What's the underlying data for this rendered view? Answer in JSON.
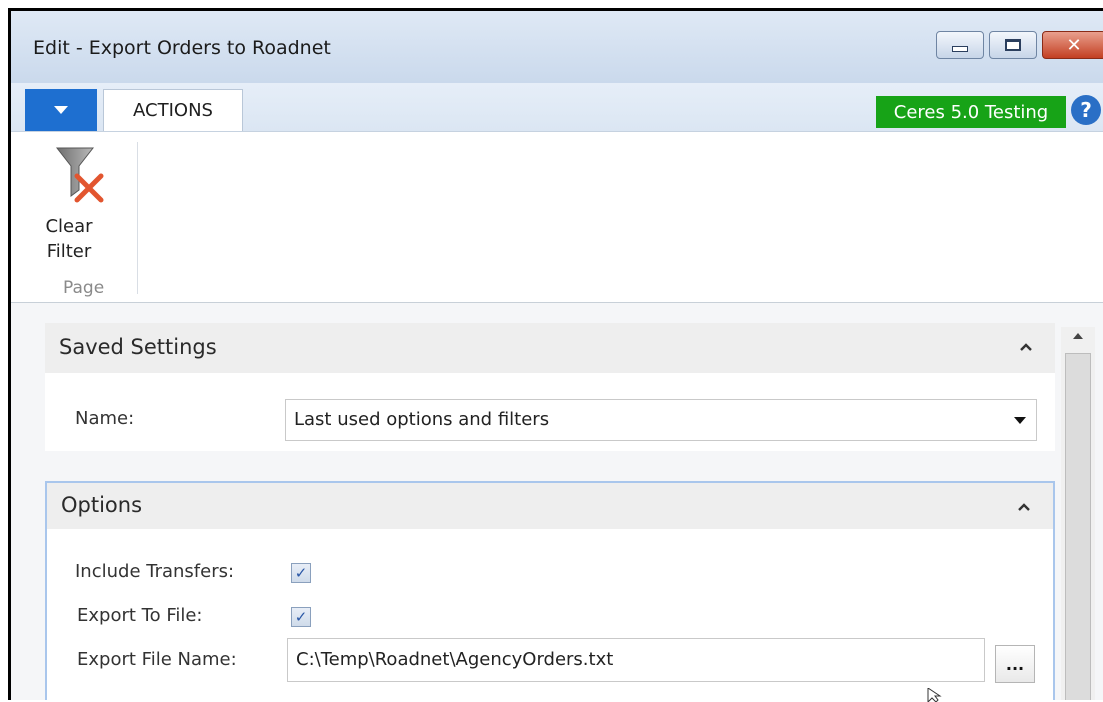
{
  "window": {
    "title": "Edit - Export Orders to Roadnet",
    "controls": {
      "minimize_icon": "minimize-icon",
      "maximize_icon": "maximize-icon",
      "close_icon": "close-icon",
      "close_glyph": "✕"
    }
  },
  "ribbon": {
    "tab_actions": "ACTIONS",
    "environment_badge": "Ceres 5.0 Testing",
    "help_glyph": "?",
    "groups": [
      {
        "label": "Page",
        "buttons": [
          {
            "label_line1": "Clear",
            "label_line2": "Filter",
            "icon": "clear-filter-icon"
          }
        ]
      }
    ]
  },
  "saved_settings": {
    "title": "Saved Settings",
    "name_label": "Name:",
    "name_value": "Last used options and filters"
  },
  "options": {
    "title": "Options",
    "include_transfers_label": "Include Transfers:",
    "include_transfers_checked": true,
    "export_to_file_label": "Export To File:",
    "export_to_file_checked": true,
    "export_file_name_label": "Export File Name:",
    "export_file_name_value": "C:\\Temp\\Roadnet\\AgencyOrders.txt",
    "browse_label": "..."
  },
  "colors": {
    "environment_badge": "#17a317",
    "app_menu": "#1e6fd0",
    "close_button": "#c33f22"
  }
}
